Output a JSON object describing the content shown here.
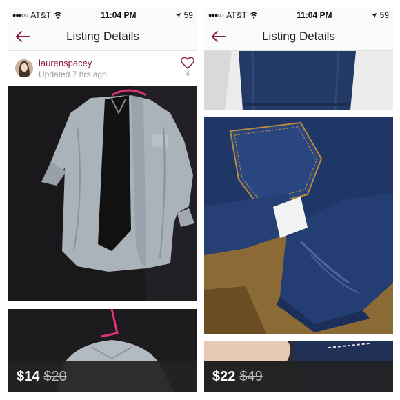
{
  "left": {
    "status": {
      "carrier": "AT&T",
      "time": "11:04 PM",
      "battery": "59"
    },
    "nav": {
      "title": "Listing Details",
      "back_icon": "back-arrow-icon"
    },
    "seller": {
      "username": "laurenspacey",
      "updated": "Updated 7 hrs ago",
      "like_count": "4"
    },
    "price": {
      "current": "$14",
      "original": "$20"
    }
  },
  "right": {
    "status": {
      "carrier": "AT&T",
      "time": "11:04 PM",
      "battery": "59"
    },
    "nav": {
      "title": "Listing Details",
      "back_icon": "back-arrow-icon"
    },
    "price": {
      "current": "$22",
      "original": "$49"
    }
  },
  "colors": {
    "accent": "#8a1c3a",
    "price_bar": "#222222"
  }
}
